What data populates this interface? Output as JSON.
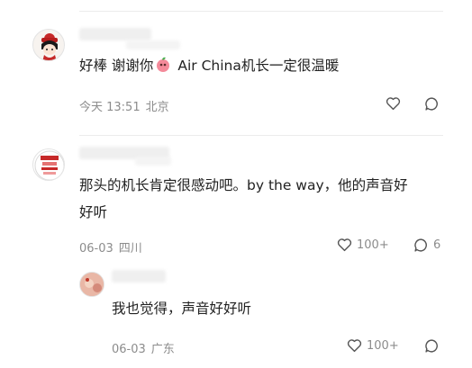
{
  "comments": [
    {
      "text_prefix": "好棒 谢谢你",
      "emoji": "peach-emoji",
      "text_suffix": " Air China机长一定很温暖",
      "time": "今天 13:51",
      "location": "北京"
    },
    {
      "text_line1": "那头的机长肯定很感动吧。by the way，他的声音好",
      "text_line2": "好听",
      "time": "06-03",
      "location": "四川",
      "like_count": "100+",
      "reply_count": "6"
    }
  ],
  "reply": {
    "text": "我也觉得，声音好好听",
    "time": "06-03",
    "location": "广东",
    "like_count": "100+"
  },
  "colors": {
    "text": "#222222",
    "meta": "#8c8c8c",
    "divider": "#ececec"
  }
}
